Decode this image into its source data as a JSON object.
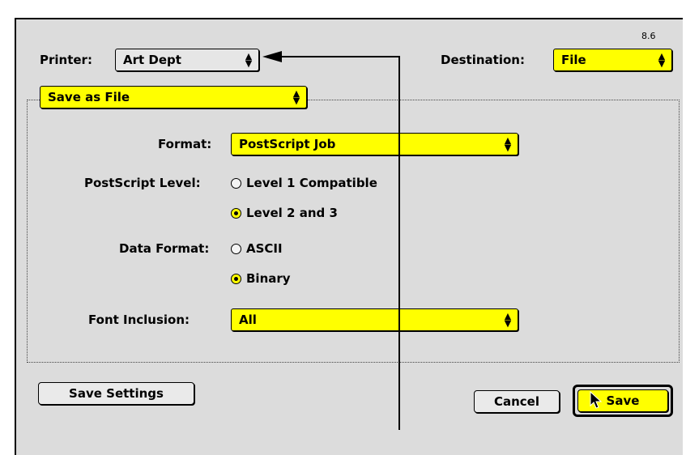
{
  "dialog": {
    "version": "8.6",
    "printer_label": "Printer:",
    "printer_value": "Art Dept",
    "destination_label": "Destination:",
    "destination_value": "File",
    "panel_value": "Save as File"
  },
  "form": {
    "format_label": "Format:",
    "format_value": "PostScript Job",
    "ps_level_label": "PostScript Level:",
    "ps_level_options": [
      "Level 1 Compatible",
      "Level 2 and 3"
    ],
    "ps_level_selected": "Level 2 and 3",
    "data_format_label": "Data Format:",
    "data_format_options": [
      "ASCII",
      "Binary"
    ],
    "data_format_selected": "Binary",
    "font_inclusion_label": "Font Inclusion:",
    "font_inclusion_value": "All"
  },
  "buttons": {
    "save_settings": "Save Settings",
    "cancel": "Cancel",
    "save": "Save"
  },
  "icons": {
    "popup_arrows": "up-down-arrows-icon",
    "callout": "callout-arrow-icon",
    "cursor": "mouse-pointer-icon"
  },
  "colors": {
    "highlight": "#ffff00",
    "dialog_bg": "#dcdcdc"
  }
}
